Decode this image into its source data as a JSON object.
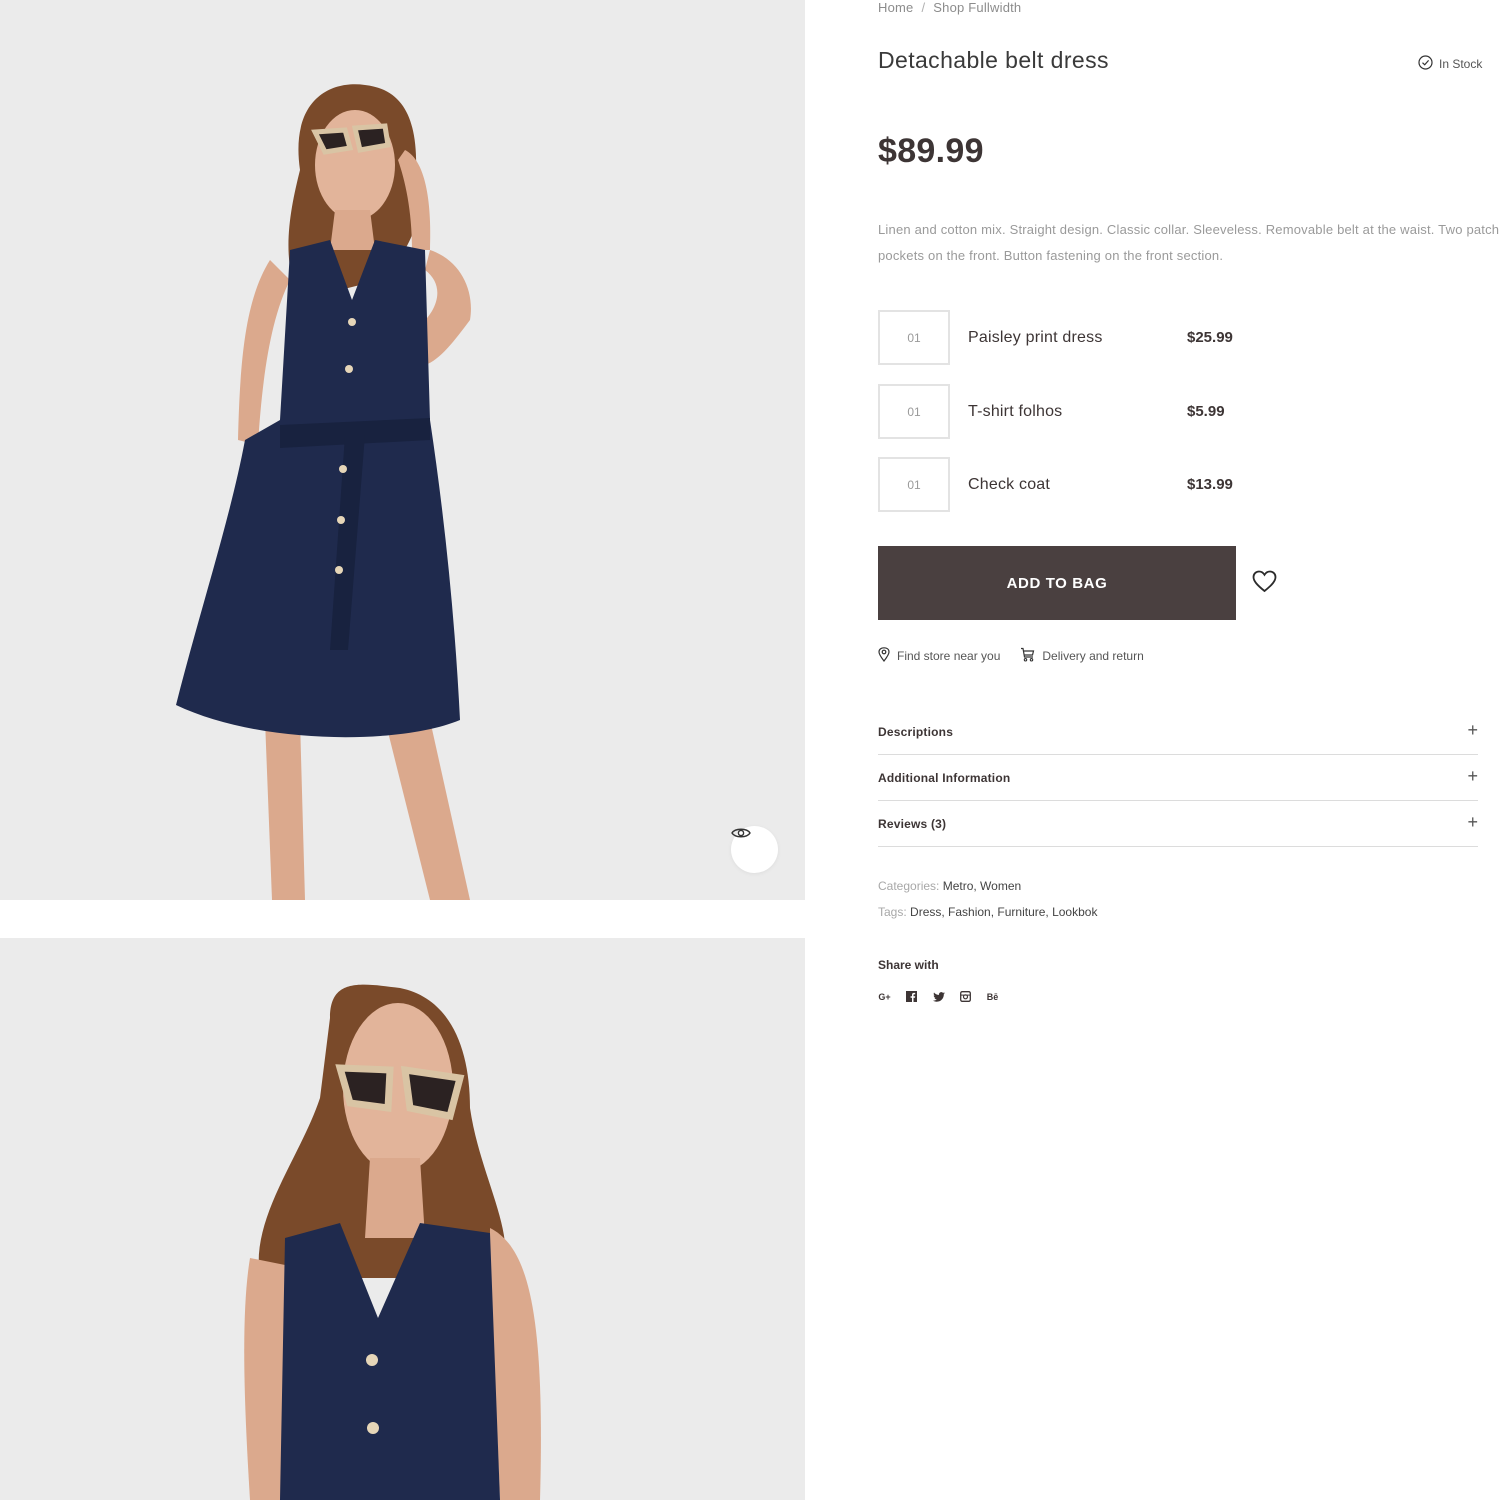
{
  "breadcrumb": {
    "home": "Home",
    "separator": "/",
    "current": "Shop Fullwidth"
  },
  "product": {
    "title": "Detachable belt dress",
    "stock": "In Stock",
    "price": "$89.99",
    "description": "Linen and cotton mix. Straight design. Classic collar. Sleeveless. Removable belt at the waist. Two patch pockets on the front. Button fastening on the front section."
  },
  "bundle": [
    {
      "qty": "01",
      "name": "Paisley print dress",
      "price": "$25.99"
    },
    {
      "qty": "01",
      "name": "T-shirt folhos",
      "price": "$5.99"
    },
    {
      "qty": "01",
      "name": "Check coat",
      "price": "$13.99"
    }
  ],
  "actions": {
    "add_to_bag": "ADD TO BAG",
    "find_store": "Find store near you",
    "delivery": "Delivery and return"
  },
  "accordion": [
    {
      "label": "Descriptions",
      "icon": "+"
    },
    {
      "label": "Additional Information",
      "icon": "+"
    },
    {
      "label": "Reviews (3)",
      "icon": "+"
    }
  ],
  "meta": {
    "categories_label": "Categories:",
    "categories": "Metro, Women",
    "tags_label": "Tags:",
    "tags": "Dress, Fashion, Furniture, Lookbok"
  },
  "share": {
    "label": "Share with",
    "icons": [
      {
        "name": "google-plus-icon",
        "glyph": "G+"
      },
      {
        "name": "facebook-icon",
        "glyph": "f"
      },
      {
        "name": "twitter-icon",
        "glyph": "t"
      },
      {
        "name": "instagram-icon",
        "glyph": "ig"
      },
      {
        "name": "behance-icon",
        "glyph": "Bē"
      }
    ]
  },
  "colors": {
    "accent": "#4a4040",
    "text": "#3d3535",
    "muted": "#9a9a9a",
    "image_bg": "#ebebeb",
    "dress": "#1f2a4d"
  }
}
